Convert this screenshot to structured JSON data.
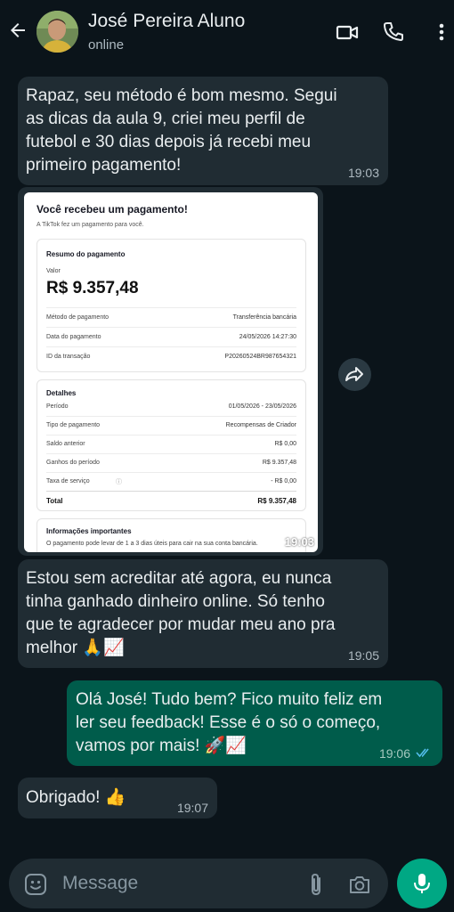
{
  "header": {
    "contact_name": "José Pereira Aluno",
    "status": "online"
  },
  "messages": [
    {
      "direction": "in",
      "text": "Rapaz, seu método é bom mesmo. Segui\nas dicas da aula 9, criei meu perfil de\nfutebol e 30 dias depois já recebi meu\nprimeiro pagamento!",
      "time": "19:03"
    },
    {
      "direction": "in",
      "type": "image",
      "time": "19:03"
    },
    {
      "direction": "in",
      "text": "Estou sem acreditar até agora, eu nunca\ntinha ganhado dinheiro online. Só tenho\nque te agradecer por mudar meu ano pra\nmelhor 🙏📈",
      "time": "19:05"
    },
    {
      "direction": "out",
      "text": "Olá José! Tudo bem? Fico muito feliz em\nler seu feedback! Esse é o só o começo,\nvamos por mais! 🚀📈",
      "time": "19:06",
      "status": "read"
    },
    {
      "direction": "in",
      "text": "Obrigado! 👍",
      "time": "19:07"
    }
  ],
  "receipt": {
    "title": "Você recebeu um pagamento!",
    "subtitle": "A TikTok fez um pagamento para você.",
    "summary": {
      "heading": "Resumo do pagamento",
      "value_label": "Valor",
      "amount": "R$ 9.357,48",
      "rows": [
        {
          "label": "Método de pagamento",
          "value": "Transferência bancária"
        },
        {
          "label": "Data do pagamento",
          "value": "24/05/2026 14:27:30"
        },
        {
          "label": "ID da transação",
          "value": "P20260524BR987654321"
        }
      ]
    },
    "details": {
      "heading": "Detalhes",
      "rows": [
        {
          "label": "Período",
          "value": "01/05/2026 - 23/05/2026"
        },
        {
          "label": "Tipo de pagamento",
          "value": "Recompensas de Criador"
        },
        {
          "label": "Saldo anterior",
          "value": "R$ 0,00"
        },
        {
          "label": "Ganhos do período",
          "value": "R$ 9.357,48"
        },
        {
          "label": "Taxa de serviço",
          "value": "- R$ 0,00"
        }
      ],
      "total_label": "Total",
      "total_value": "R$ 9.357,48"
    },
    "info": {
      "heading": "Informações importantes",
      "text": "O pagamento pode levar de 1 a 3 dias úteis para cair na sua conta bancária."
    }
  },
  "input": {
    "placeholder": "Message"
  },
  "colors": {
    "background": "#0b141a",
    "incoming_bubble": "#202c33",
    "outgoing_bubble": "#005c4b",
    "accent": "#00a884",
    "read_ticks": "#53bdeb"
  },
  "icons": [
    "back-arrow-icon",
    "video-call-icon",
    "phone-icon",
    "more-options-icon",
    "forward-icon",
    "emoji-icon",
    "attach-icon",
    "camera-icon",
    "mic-icon",
    "double-check-icon",
    "info-icon"
  ]
}
